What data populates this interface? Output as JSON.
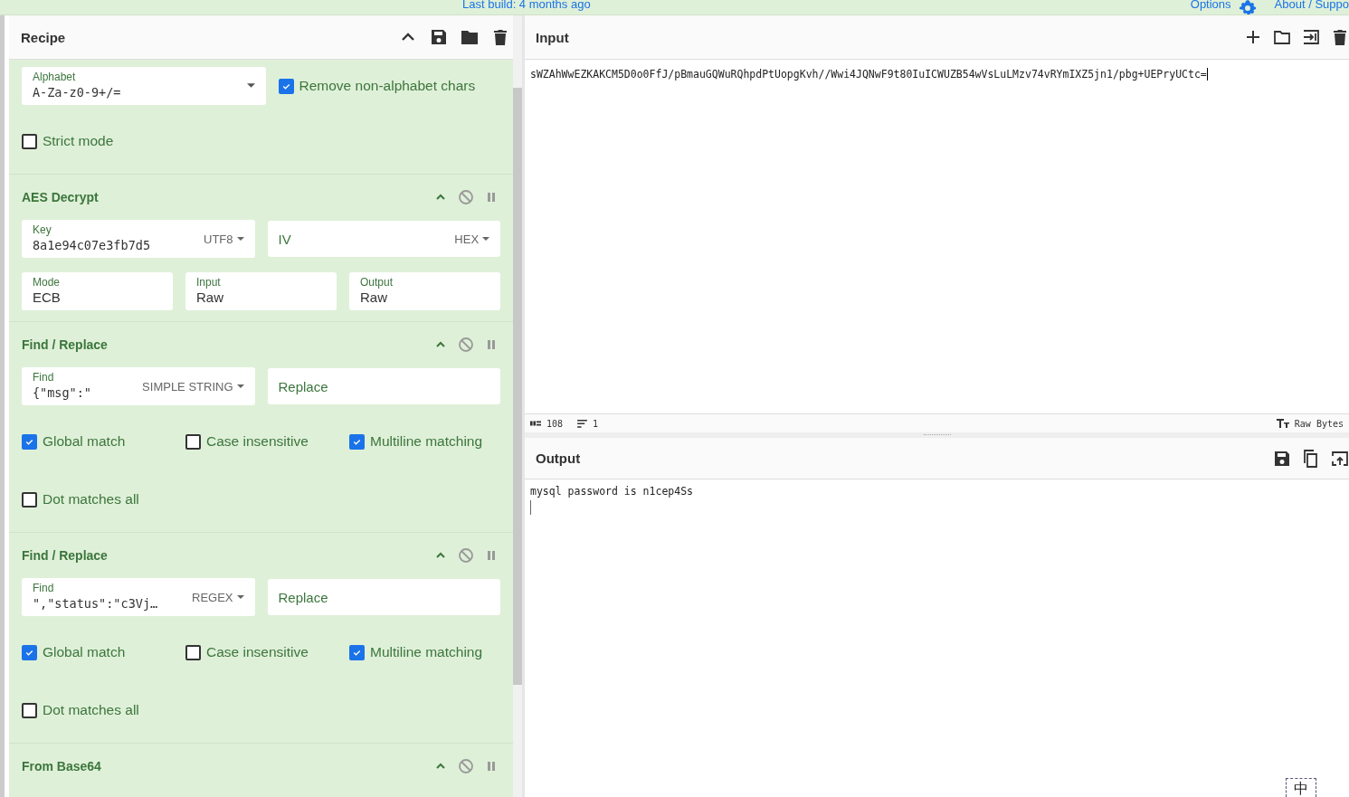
{
  "top_bar": {
    "build_note": "Last build: 4 months ago",
    "links": [
      "Options",
      "About / Suppo"
    ]
  },
  "recipe": {
    "title": "Recipe",
    "operations": [
      {
        "lines": [
          {
            "args": [
              {
                "kind": "combo",
                "label": "Alphabet",
                "value": "A-Za-z0-9+/="
              },
              {
                "kind": "checkbox",
                "label": "Remove non-alphabet chars",
                "checked": true
              }
            ]
          },
          {
            "args": [
              {
                "kind": "checkbox",
                "label": "Strict mode",
                "checked": false
              }
            ]
          }
        ]
      },
      {
        "title": "AES Decrypt",
        "lines": [
          {
            "args": [
              {
                "kind": "text",
                "label": "Key",
                "value": "8a1e94c07e3fb7d5",
                "option": "UTF8"
              },
              {
                "kind": "empty",
                "placeholder": "IV",
                "option": "HEX"
              }
            ]
          },
          {
            "args": [
              {
                "kind": "select",
                "label": "Mode",
                "value": "ECB"
              },
              {
                "kind": "select",
                "label": "Input",
                "value": "Raw"
              },
              {
                "kind": "select",
                "label": "Output",
                "value": "Raw"
              }
            ]
          }
        ]
      },
      {
        "title": "Find / Replace",
        "lines": [
          {
            "args": [
              {
                "kind": "text",
                "label": "Find",
                "value": "{\"msg\":\"",
                "option": "SIMPLE STRING"
              },
              {
                "kind": "empty",
                "placeholder": "Replace"
              }
            ]
          },
          {
            "args": [
              {
                "kind": "checkbox",
                "label": "Global match",
                "checked": true
              },
              {
                "kind": "checkbox",
                "label": "Case insensitive",
                "checked": false
              },
              {
                "kind": "checkbox",
                "label": "Multiline matching",
                "checked": true
              }
            ]
          },
          {
            "args": [
              {
                "kind": "checkbox",
                "label": "Dot matches all",
                "checked": false
              }
            ]
          }
        ]
      },
      {
        "title": "Find / Replace",
        "lines": [
          {
            "args": [
              {
                "kind": "text",
                "label": "Find",
                "value": "\",\"status\":\"c3Vj…",
                "option": "REGEX"
              },
              {
                "kind": "empty",
                "placeholder": "Replace"
              }
            ]
          },
          {
            "args": [
              {
                "kind": "checkbox",
                "label": "Global match",
                "checked": true
              },
              {
                "kind": "checkbox",
                "label": "Case insensitive",
                "checked": false
              },
              {
                "kind": "checkbox",
                "label": "Multiline matching",
                "checked": true
              }
            ]
          },
          {
            "args": [
              {
                "kind": "checkbox",
                "label": "Dot matches all",
                "checked": false
              }
            ]
          }
        ]
      },
      {
        "title": "From Base64"
      }
    ]
  },
  "input": {
    "title": "Input",
    "text": "sWZAhWwEZKAKCM5D0o0FfJ/pBmauGQWuRQhpdPtUopgKvh//Wwi4JQNwF9t80IuICWUZB54wVsLuLMzv74vRYmIXZ5jn1/pbg+UEPryUCtc=",
    "status": {
      "length": "108",
      "lines": "1",
      "encoding": "Raw Bytes"
    }
  },
  "output": {
    "title": "Output",
    "text": "mysql password is n1cep4Ss"
  },
  "ime_indicator": "中"
}
